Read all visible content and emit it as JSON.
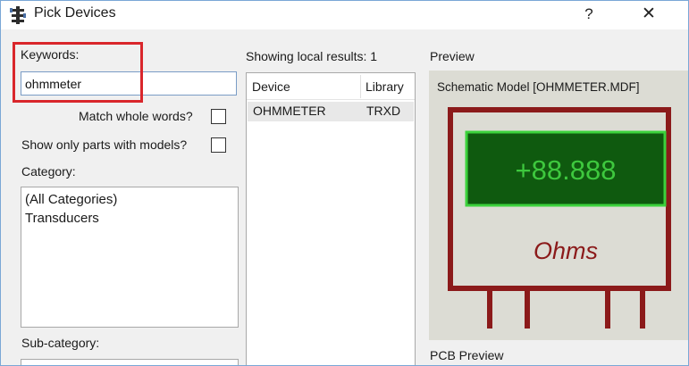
{
  "window": {
    "title": "Pick Devices",
    "help_label": "?",
    "close_label": "✕"
  },
  "left_panel": {
    "keywords_label": "Keywords:",
    "keywords_value": "ohmmeter",
    "match_whole_words_label": "Match whole words?",
    "show_only_models_label": "Show only parts with models?",
    "category_label": "Category:",
    "categories": [
      "(All Categories)",
      "Transducers"
    ],
    "subcategory_label": "Sub-category:"
  },
  "results": {
    "header": "Showing local results: 1",
    "columns": [
      "Device",
      "Library"
    ],
    "rows": [
      {
        "device": "OHMMETER",
        "library": "TRXD"
      }
    ]
  },
  "preview": {
    "label": "Preview",
    "schematic_label": "Schematic Model [OHMMETER.MDF]",
    "display_value": "+88.888",
    "unit_text": "Ohms",
    "pcb_preview_label": "PCB Preview",
    "colors": {
      "body_outline": "#8b1a1a",
      "display_bg": "#0f5a0f",
      "display_border": "#3cd23c",
      "display_text": "#3ec83e",
      "unit_text": "#8b1a1a",
      "preview_bg": "#dcdcd4"
    }
  },
  "annotation": {
    "highlight_color": "#d9262b"
  }
}
